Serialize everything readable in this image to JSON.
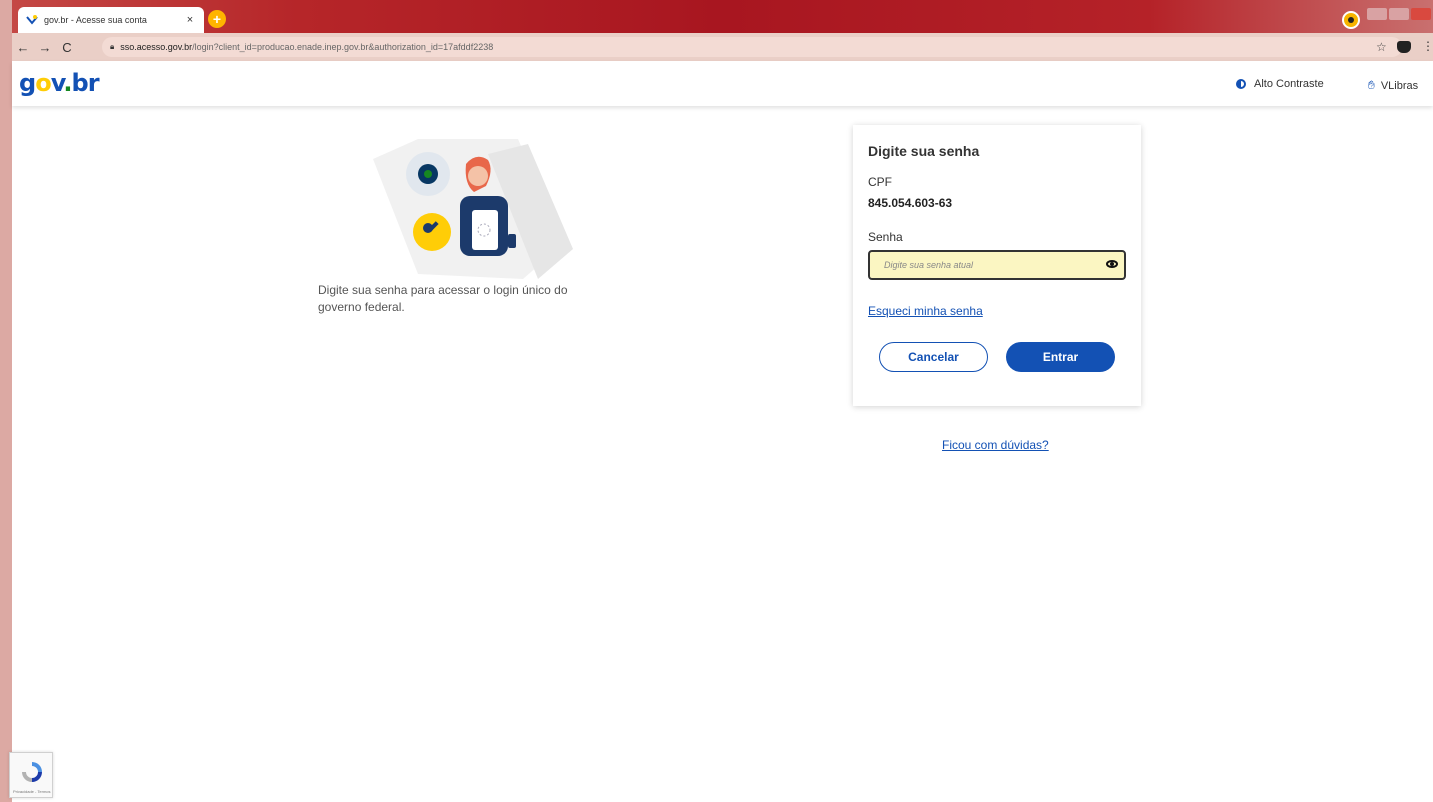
{
  "browser": {
    "tab_title": "gov.br - Acesse sua conta",
    "tab_close": "×",
    "new_tab": "+",
    "url_host": "sso.acesso.gov.br",
    "url_path": "/login?client_id=producao.enade.inep.gov.br&authorization_id=17afddf2238"
  },
  "header": {
    "logo_parts": [
      "g",
      "o",
      "v",
      ".",
      "b",
      "r"
    ],
    "contrast_label": "Alto Contraste",
    "vlibras_label": "VLibras"
  },
  "intro": {
    "description": "Digite sua senha para acessar o login único do governo federal."
  },
  "form": {
    "title": "Digite sua senha",
    "cpf_label": "CPF",
    "cpf_value": "845.054.603-63",
    "password_label": "Senha",
    "password_placeholder": "Digite sua senha atual",
    "forgot_link": "Esqueci minha senha",
    "cancel_button": "Cancelar",
    "submit_button": "Entrar"
  },
  "help_link": "Ficou com dúvidas?",
  "recaptcha": {
    "text": "Privacidade - Termos"
  },
  "colors": {
    "primary": "#1351b4",
    "field_bg": "#fbf6c2",
    "logo_yellow": "#ffcd07"
  }
}
